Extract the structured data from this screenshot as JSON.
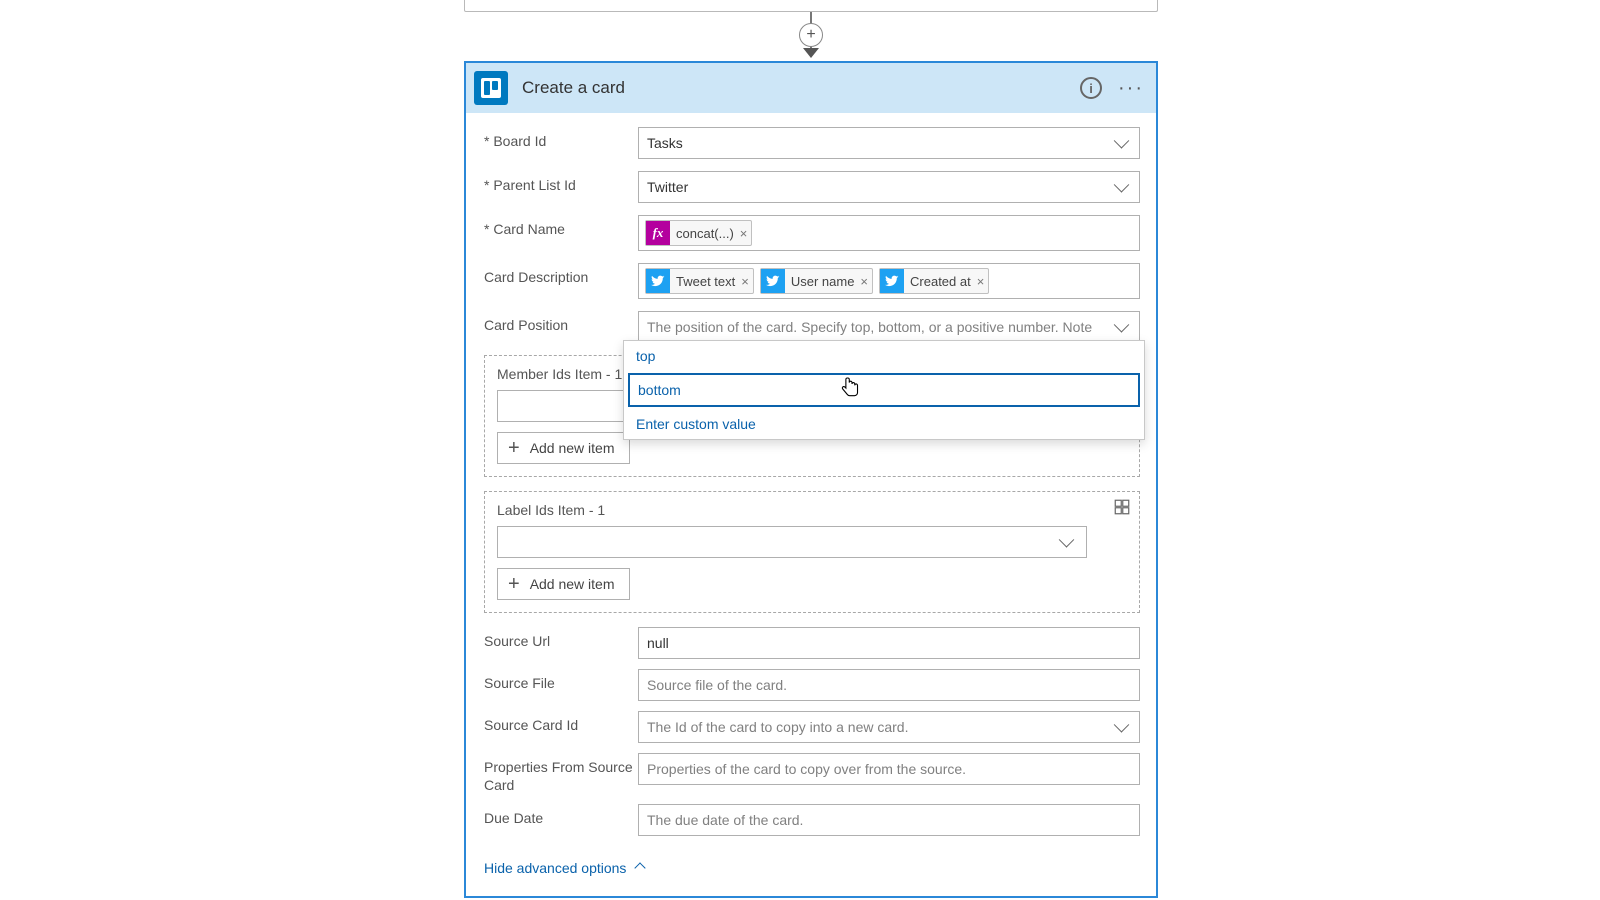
{
  "header": {
    "title": "Create a card"
  },
  "fields": {
    "board_id": {
      "label": "Board Id",
      "value": "Tasks",
      "required": true
    },
    "parent_list_id": {
      "label": "Parent List Id",
      "value": "Twitter",
      "required": true
    },
    "card_name": {
      "label": "Card Name",
      "required": true,
      "token_fx": "concat(...)"
    },
    "card_description": {
      "label": "Card Description",
      "tokens": [
        "Tweet text",
        "User name",
        "Created at"
      ]
    },
    "card_position": {
      "label": "Card Position",
      "placeholder": "The position of the card. Specify top, bottom, or a positive number. Note",
      "options": {
        "top": "top",
        "bottom": "bottom",
        "custom": "Enter custom value"
      }
    },
    "member_ids": {
      "label": "Member Ids Item - 1"
    },
    "label_ids": {
      "label": "Label Ids Item - 1"
    },
    "source_url": {
      "label": "Source Url",
      "value": "null"
    },
    "source_file": {
      "label": "Source File",
      "placeholder": "Source file of the card."
    },
    "source_card_id": {
      "label": "Source Card Id",
      "placeholder": "The Id of the card to copy into a new card."
    },
    "props_from_source": {
      "label": "Properties From Source Card",
      "placeholder": "Properties of the card to copy over from the source."
    },
    "due_date": {
      "label": "Due Date",
      "placeholder": "The due date of the card."
    }
  },
  "buttons": {
    "add_new_item": "Add new item",
    "hide_advanced": "Hide advanced options"
  }
}
